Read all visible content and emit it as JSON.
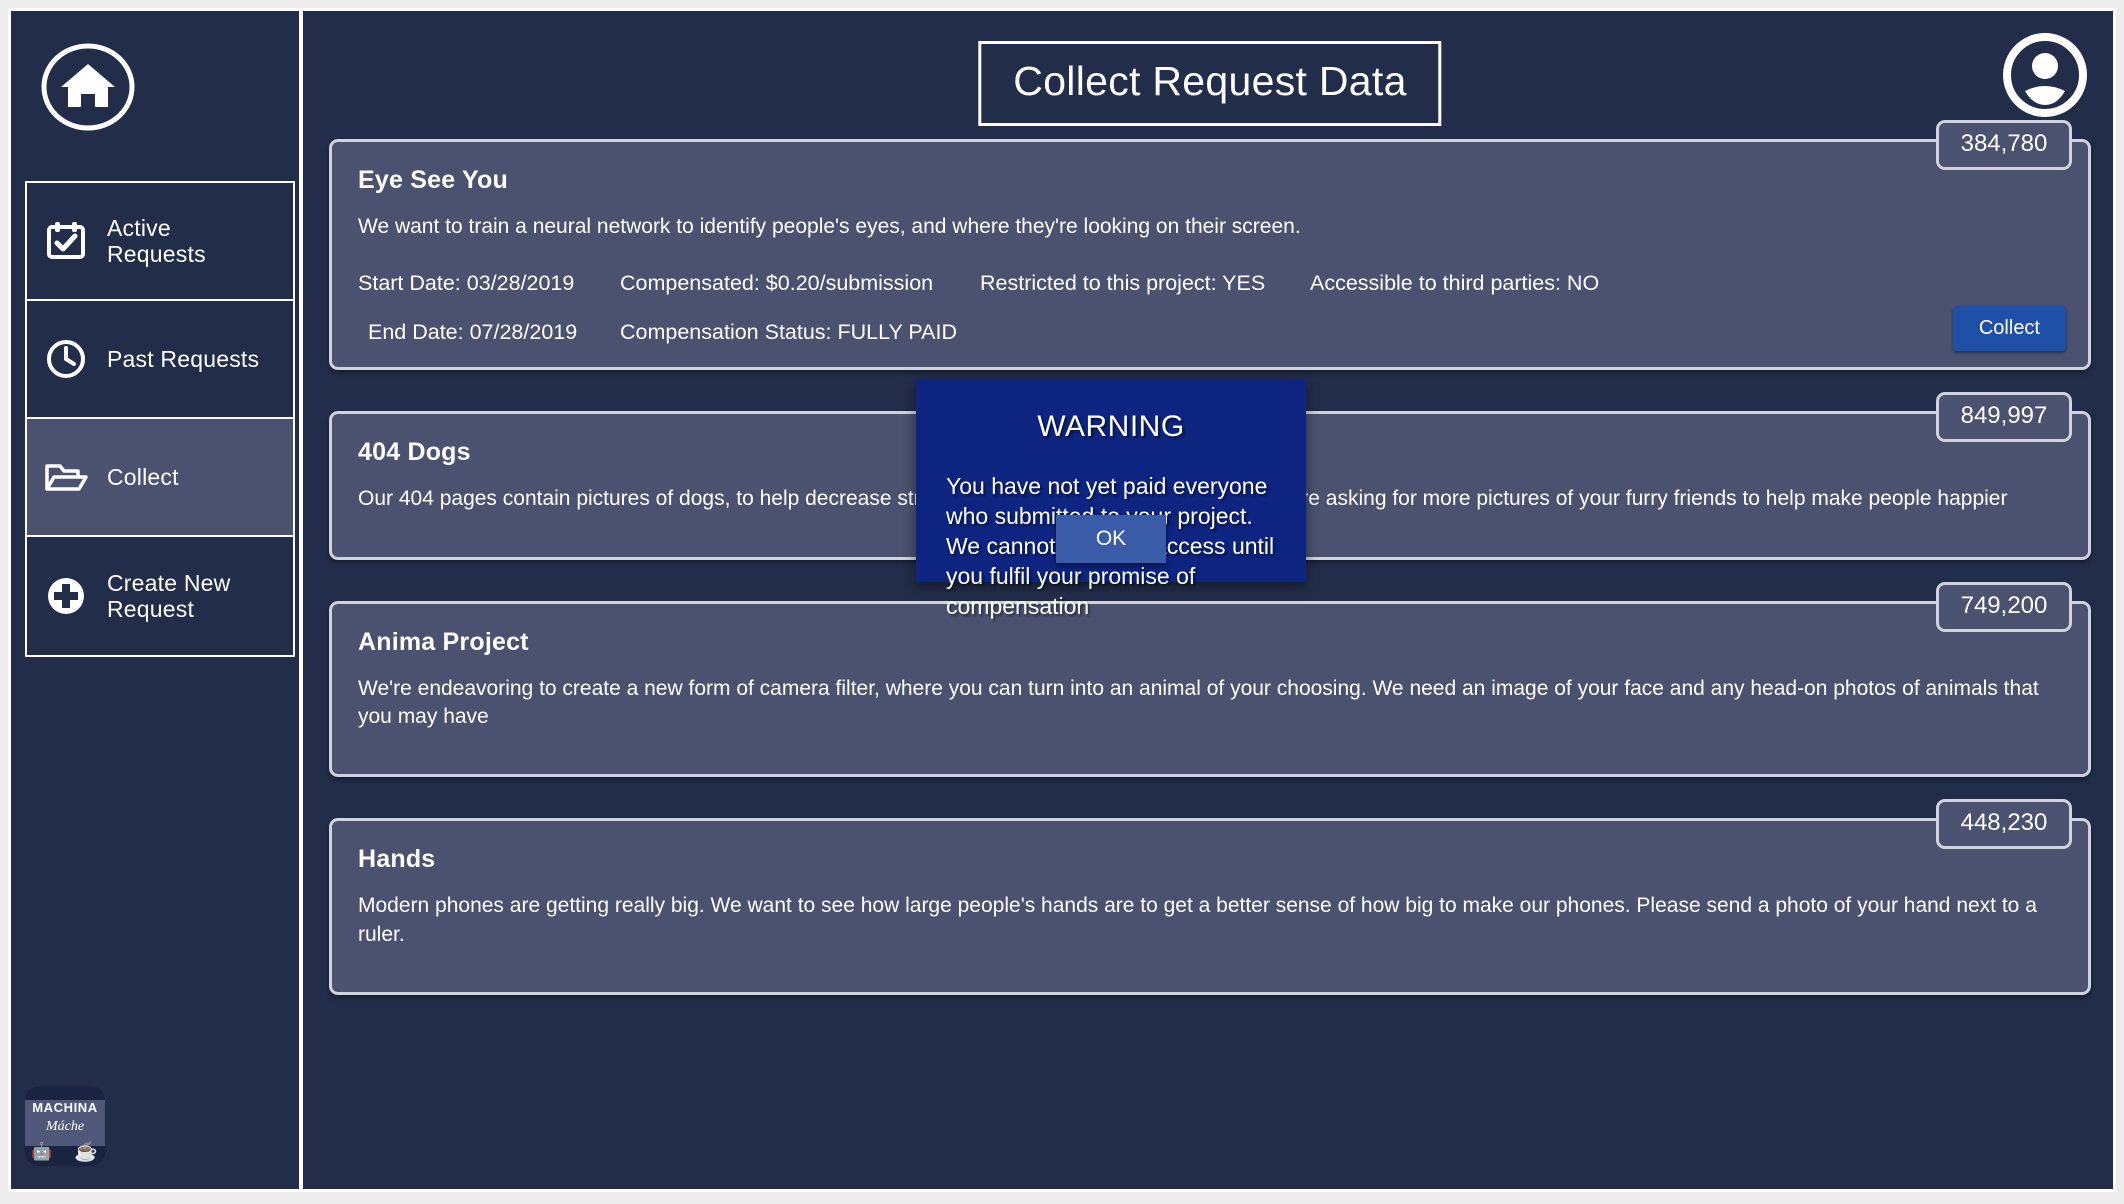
{
  "header": {
    "title": "Collect Request Data",
    "avatar_icon": "user-avatar-icon"
  },
  "sidebar": {
    "home_icon": "home-icon",
    "items": [
      {
        "label": "Active Requests",
        "icon": "calendar-check-icon",
        "active": false
      },
      {
        "label": "Past Requests",
        "icon": "clock-icon",
        "active": false
      },
      {
        "label": "Collect",
        "icon": "folder-open-icon",
        "active": true
      },
      {
        "label": "Create New Request",
        "icon": "plus-circle-icon",
        "active": false
      }
    ],
    "brand": {
      "line1": "MACHINA",
      "line2": "Máche",
      "robot_icon": "robot-icon",
      "cup_icon": "coffee-cup-icon"
    }
  },
  "requests": [
    {
      "title": "Eye See You",
      "description": "We want to train a neural network to identify people's eyes, and where they're looking on their screen.",
      "count": "384,780",
      "meta": {
        "start_date": "Start Date: 03/28/2019",
        "compensated": "Compensated: $0.20/submission",
        "restricted": "Restricted to this project: YES",
        "third_parties": "Accessible to third parties: NO",
        "end_date": "End Date: 07/28/2019",
        "compensation_status": "Compensation Status: FULLY PAID"
      },
      "collect_label": "Collect"
    },
    {
      "title": "404 Dogs",
      "description": "Our 404 pages contain pictures of dogs, to help decrease stress in visitors when they hit an error. We're asking for more pictures of your furry friends to help make people happier",
      "count": "849,997"
    },
    {
      "title": "Anima Project",
      "description": "We're endeavoring to create a new form of camera filter, where you can turn into an animal of your choosing. We need an image of your face and any head-on photos of animals that you may have",
      "count": "749,200"
    },
    {
      "title": "Hands",
      "description": "Modern phones are getting really big. We want to see how large people's hands are to get a better sense of how big to make our phones. Please send a photo of your hand next to a ruler.",
      "count": "448,230"
    }
  ],
  "modal": {
    "title": "WARNING",
    "message": "You have not yet paid everyone who submitted to your project. We cannot give you access until you fulfil your promise of compensation",
    "ok_label": "OK"
  },
  "colors": {
    "page_background": "#222d4a",
    "card_background": "#4a5270",
    "card_border": "#cfd3dd",
    "accent_button": "#1e50a8",
    "modal_background": "#0d2480",
    "modal_button": "#3a5ca8",
    "text": "#ffffff"
  }
}
